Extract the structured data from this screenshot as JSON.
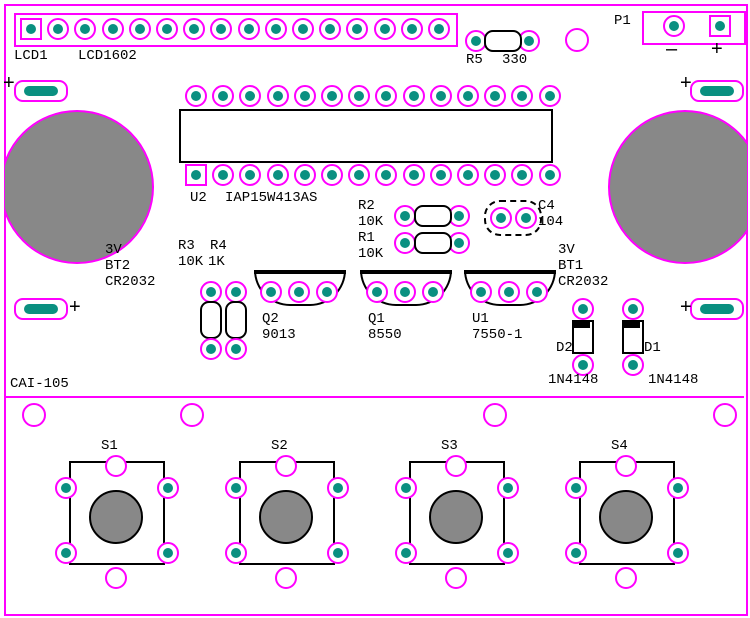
{
  "board_id": "CAI-105",
  "connectors": {
    "lcd": {
      "ref": "LCD1",
      "part": "LCD1602",
      "pins": 16
    },
    "p1": {
      "ref": "P1",
      "plus": "+",
      "minus": "–"
    }
  },
  "ic": {
    "u2": {
      "ref": "U2",
      "part": "IAP15W413AS"
    }
  },
  "resistors": {
    "r1": {
      "ref": "R1",
      "value": "10K"
    },
    "r2": {
      "ref": "R2",
      "value": "10K"
    },
    "r3": {
      "ref": "R3",
      "value": "10K"
    },
    "r4": {
      "ref": "R4",
      "value": "1K"
    },
    "r5": {
      "ref": "R5",
      "value": "330"
    }
  },
  "capacitors": {
    "c4": {
      "ref": "C4",
      "value": "104"
    }
  },
  "transistors": {
    "q1": {
      "ref": "Q1",
      "part": "8550"
    },
    "q2": {
      "ref": "Q2",
      "part": "9013"
    }
  },
  "regulator": {
    "u1": {
      "ref": "U1",
      "part": "7550-1"
    }
  },
  "diodes": {
    "d1": {
      "ref": "D1",
      "part": "1N4148"
    },
    "d2": {
      "ref": "D2",
      "part": "1N4148"
    }
  },
  "batteries": {
    "bt1": {
      "ref": "BT1",
      "voltage": "3V",
      "part": "CR2032"
    },
    "bt2": {
      "ref": "BT2",
      "voltage": "3V",
      "part": "CR2032"
    }
  },
  "switches": {
    "s1": "S1",
    "s2": "S2",
    "s3": "S3",
    "s4": "S4"
  }
}
